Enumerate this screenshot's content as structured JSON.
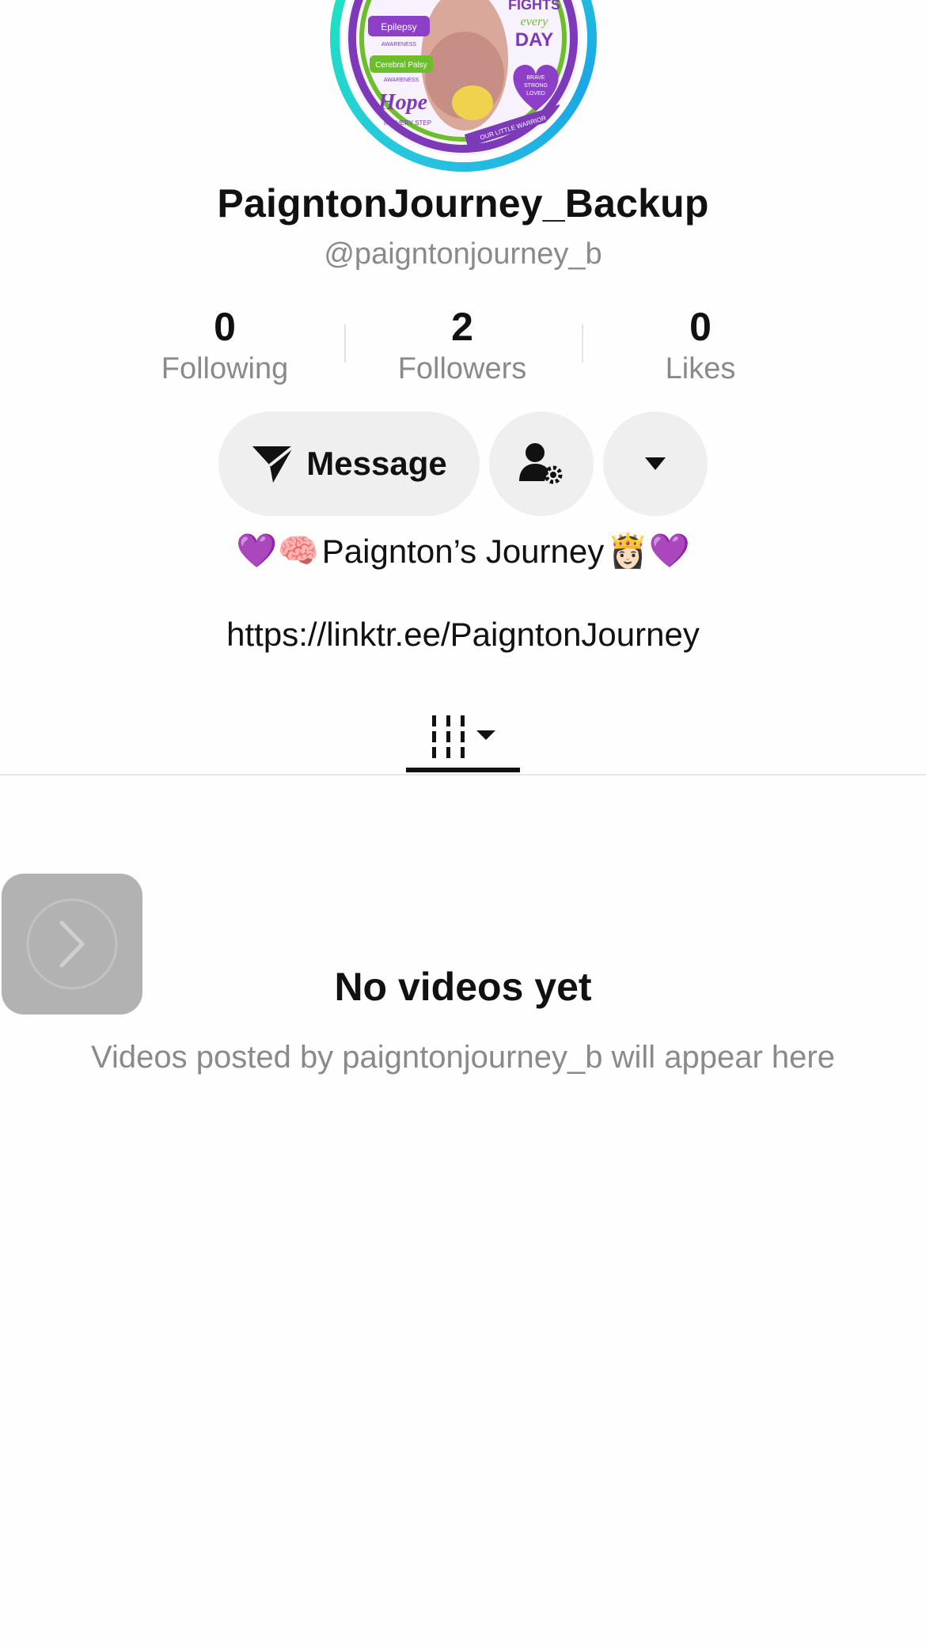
{
  "profile": {
    "display_name": "PaigntonJourney_Backup",
    "handle": "@paigntonjourney_b",
    "avatar_text": {
      "top_left": "Epilepsy",
      "awareness_1": "AWARENESS",
      "middle_left": "Cerebral Palsy",
      "awareness_2": "AWARENESS",
      "hope": "Hope",
      "in_every_step": "IN EVERY STEP",
      "fights": "FIGHTS",
      "every": "every",
      "day": "DAY",
      "brave": "BRAVE",
      "strong": "STRONG",
      "loved": "LOVED",
      "ribbon": "OUR LITTLE WARRIOR"
    }
  },
  "stats": [
    {
      "value": "0",
      "label": "Following"
    },
    {
      "value": "2",
      "label": "Followers"
    },
    {
      "value": "0",
      "label": "Likes"
    }
  ],
  "actions": {
    "message_label": "Message",
    "icons": {
      "message": "send-icon",
      "follow_settings": "user-settings-icon",
      "more": "dropdown-caret-icon"
    }
  },
  "bio": {
    "emoji_left": "💜🧠",
    "text": "Paignton’s Journey ",
    "emoji_right": "👸🏻💜",
    "link": "https://linktr.ee/PaigntonJourney"
  },
  "tabs": {
    "active": "videos-grid",
    "icon": "grid-lines-icon"
  },
  "empty_state": {
    "title": "No videos yet",
    "subtitle": "Videos posted by paigntonjourney_b will appear here"
  },
  "colors": {
    "ring_start": "#27c4e0",
    "ring_end": "#1ee3c0",
    "button_bg": "#efefef",
    "muted_text": "#8a8a8a",
    "purple": "#8e3fc7",
    "green": "#6cbf2a"
  }
}
